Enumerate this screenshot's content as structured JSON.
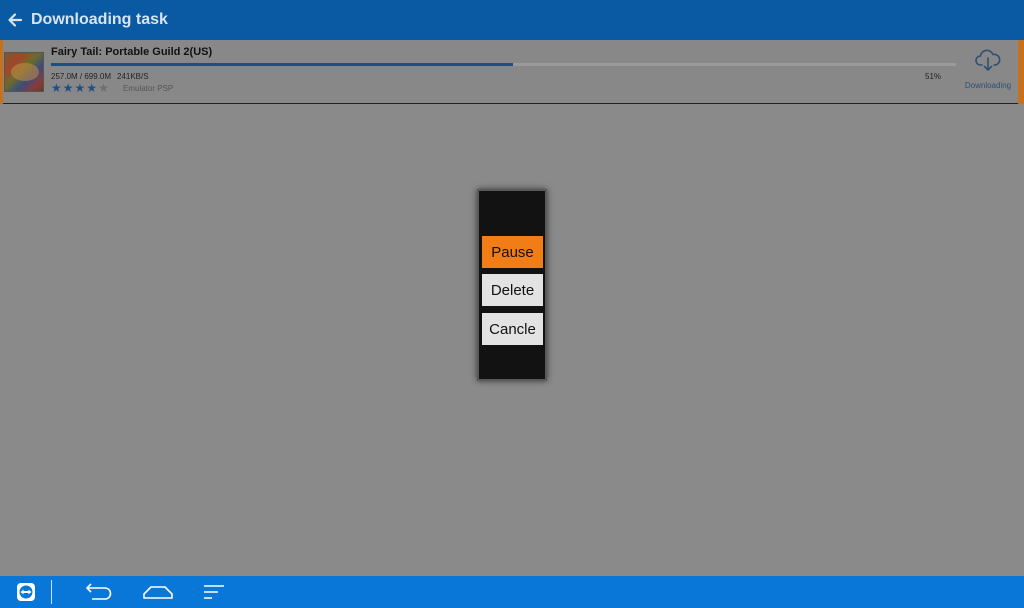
{
  "app_bar": {
    "back_icon": "arrow-left-icon",
    "title": "Downloading task",
    "color": "#0a59a3"
  },
  "task": {
    "thumbnail_icon": "game-cover-image",
    "title": "Fairy Tail: Portable Guild 2(US)",
    "size": "257.0M /  699.0M",
    "speed": "241KB/S",
    "progress_percent": 51,
    "percent_label": "51%",
    "rating": 4,
    "rating_max": 5,
    "platform": "Emulator PSP",
    "status_icon": "cloud-download-icon",
    "status_label": "Downloading",
    "accent_color": "#c8711c"
  },
  "dialog": {
    "pause_label": "Pause",
    "delete_label": "Delete",
    "cancel_label": "Cancle",
    "primary_color": "#f07d16"
  },
  "nav_bar": {
    "color": "#0977d8",
    "icons": [
      "teamviewer-icon",
      "back-icon",
      "home-icon",
      "recents-icon"
    ]
  }
}
